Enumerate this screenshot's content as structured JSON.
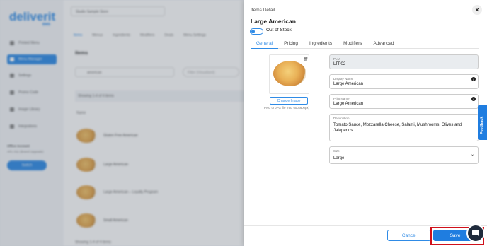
{
  "background": {
    "brand": {
      "logo": "deliverit",
      "logo_sub": "BMS"
    },
    "sidebar": {
      "items": [
        {
          "label": "Printed Menu"
        },
        {
          "label": "Menu Manager"
        },
        {
          "label": "Settings"
        },
        {
          "label": "Promo Code"
        },
        {
          "label": "Image Library"
        },
        {
          "label": "Integrations"
        }
      ],
      "office_label": "Office Account",
      "office_sub": "APL 011 (Brand Upgrade)",
      "switch_label": "Switch"
    },
    "store_select": "Studio Sample Store",
    "tabs": [
      "Items",
      "Menus",
      "Ingredients",
      "Modifiers",
      "Deals",
      "Menu Settings"
    ],
    "items_heading": "Items",
    "search_value": "american",
    "filter_placeholder": "Filter (Visualised)",
    "showing": "Showing 1-4 of 4 items",
    "name_header": "Name",
    "rows": [
      "Gluten Free American",
      "Large American",
      "Large American – Loyalty Program",
      "Small American"
    ],
    "showing_bottom": "Showing 1-4 of 4 items"
  },
  "panel": {
    "title": "Items Detail",
    "item_name": "Large American",
    "out_of_stock_label": "Out of Stock",
    "tabs": [
      "General",
      "Pricing",
      "Ingredients",
      "Modifiers",
      "Advanced"
    ],
    "change_image_label": "Change Image",
    "image_note": "PNG or JPG file (rec. 600x600px)",
    "fields": {
      "plu": {
        "label": "PLU",
        "value": "LTP02"
      },
      "display_name": {
        "label": "Display Name",
        "value": "Large American"
      },
      "print_name": {
        "label": "Print Name",
        "value": "Large American"
      },
      "description": {
        "label": "Description",
        "value": "Tomato Sauce, Mozzarella Cheese, Salami, Mushrooms, Olives and Jalapenos"
      },
      "size": {
        "label": "Size",
        "value": "Large"
      }
    },
    "cancel_label": "Cancel",
    "save_label": "Save"
  },
  "feedback_label": "Feedback",
  "icons": {
    "close": "close-icon",
    "trash": "trash-icon",
    "info": "info-icon",
    "chevron": "chevron-down-icon",
    "chat": "chat-icon"
  },
  "colors": {
    "accent": "#2f8be6",
    "highlight": "#d0111b",
    "chat": "#1f2b3c"
  }
}
